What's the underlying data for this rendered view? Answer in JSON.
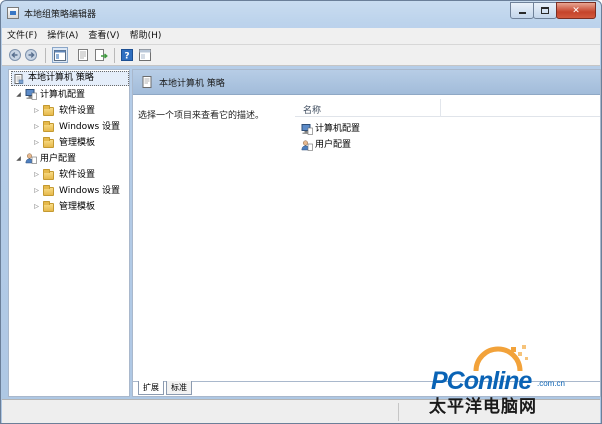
{
  "window": {
    "title": "本地组策略编辑器"
  },
  "menu": {
    "items": [
      {
        "label": "文件(F)"
      },
      {
        "label": "操作(A)"
      },
      {
        "label": "查看(V)"
      },
      {
        "label": "帮助(H)"
      }
    ]
  },
  "toolbar": {
    "icons": [
      "back-arrow-icon",
      "forward-arrow-icon",
      "show-hide-console-tree-icon",
      "properties-icon",
      "export-list-icon",
      "help-icon",
      "extended-view-icon"
    ]
  },
  "tree": {
    "root": {
      "label": "本地计算机 策略"
    },
    "computer": {
      "label": "计算机配置",
      "children": [
        {
          "label": "软件设置"
        },
        {
          "label": "Windows 设置"
        },
        {
          "label": "管理模板"
        }
      ]
    },
    "user": {
      "label": "用户配置",
      "children": [
        {
          "label": "软件设置"
        },
        {
          "label": "Windows 设置"
        },
        {
          "label": "管理模板"
        }
      ]
    }
  },
  "details": {
    "header_title": "本地计算机 策略",
    "description": "选择一个项目来查看它的描述。",
    "column_name": "名称",
    "rows": [
      {
        "label": "计算机配置"
      },
      {
        "label": "用户配置"
      }
    ]
  },
  "tabs": [
    {
      "label": "扩展"
    },
    {
      "label": "标准"
    }
  ],
  "watermark": {
    "brand": "PConline",
    "domain_suffix": ".com.cn",
    "tagline": "太平洋电脑网"
  },
  "colors": {
    "accent": "#0a63b5",
    "header_blue": "#a9c2df"
  }
}
